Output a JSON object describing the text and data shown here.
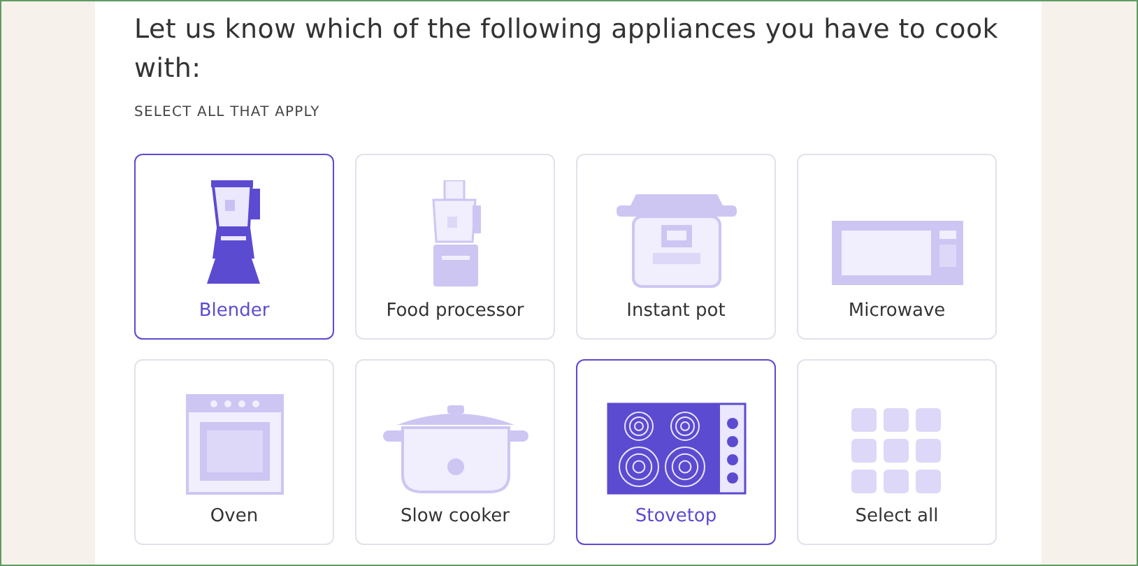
{
  "question": "Let us know which of the following appliances you have to cook with:",
  "instruction": "SELECT ALL THAT APPLY",
  "options": [
    {
      "kind": "blender",
      "label": "Blender",
      "selected": true
    },
    {
      "kind": "food-processor",
      "label": "Food processor",
      "selected": false
    },
    {
      "kind": "instant-pot",
      "label": "Instant pot",
      "selected": false
    },
    {
      "kind": "microwave",
      "label": "Microwave",
      "selected": false
    },
    {
      "kind": "oven",
      "label": "Oven",
      "selected": false
    },
    {
      "kind": "slow-cooker",
      "label": "Slow cooker",
      "selected": false
    },
    {
      "kind": "stovetop",
      "label": "Stovetop",
      "selected": true
    },
    {
      "kind": "select-all",
      "label": "Select all",
      "selected": false
    }
  ]
}
